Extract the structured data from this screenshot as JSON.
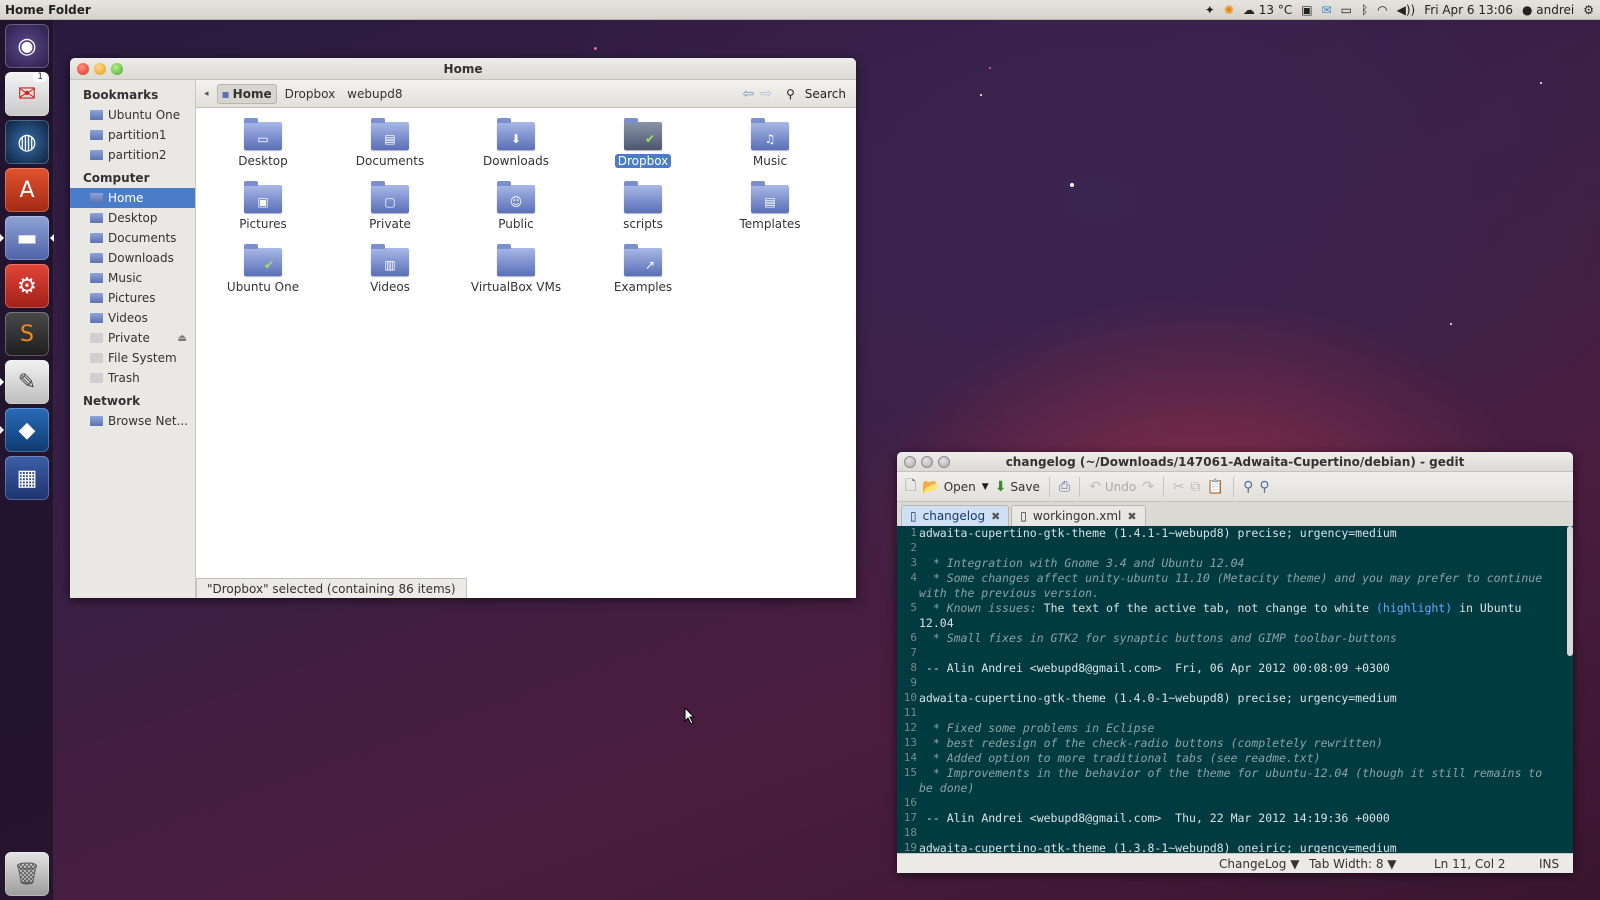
{
  "top_panel": {
    "window_title": "Home Folder",
    "temperature": "13 °C",
    "clock": "Fri Apr 6 13:06",
    "user": "andrei"
  },
  "launcher": {
    "mail_badge": "1"
  },
  "nautilus": {
    "title": "Home",
    "sidebar": {
      "bookmarks_header": "Bookmarks",
      "bookmarks": [
        "Ubuntu One",
        "partition1",
        "partition2"
      ],
      "computer_header": "Computer",
      "computer": [
        "Home",
        "Desktop",
        "Documents",
        "Downloads",
        "Music",
        "Pictures",
        "Videos",
        "Private",
        "File System",
        "Trash"
      ],
      "network_header": "Network",
      "network": [
        "Browse Net..."
      ]
    },
    "breadcrumbs": [
      "Home",
      "Dropbox",
      "webupd8"
    ],
    "search_label": "Search",
    "items": [
      "Desktop",
      "Documents",
      "Downloads",
      "Dropbox",
      "Music",
      "Pictures",
      "Private",
      "Public",
      "scripts",
      "Templates",
      "Ubuntu One",
      "Videos",
      "VirtualBox VMs",
      "Examples"
    ],
    "selected_item": "Dropbox",
    "status": "\"Dropbox\" selected (containing 86 items)"
  },
  "gedit": {
    "title": "changelog (~/Downloads/147061-Adwaita-Cupertino/debian) - gedit",
    "toolbar": {
      "open": "Open",
      "save": "Save",
      "undo": "Undo"
    },
    "tabs": [
      "changelog",
      "workingon.xml"
    ],
    "line_numbers": [
      "1",
      "2",
      "3",
      "4",
      "5",
      "6",
      "7",
      "8",
      "9",
      "10",
      "11",
      "12",
      "13",
      "14",
      "15",
      "16",
      "17",
      "18",
      "19"
    ],
    "lines": {
      "l1": "adwaita-cupertino-gtk-theme (1.4.1-1~webupd8) precise; urgency=medium",
      "l3": "  * Integration with Gnome 3.4 and Ubuntu 12.04",
      "l4": "  * Some changes affect unity-ubuntu 11.10 (Metacity theme) and you may prefer to continue with the previous version.",
      "l5a": "  * Known issues: ",
      "l5b": "The text of the active tab, not change to white ",
      "l5c": "(highlight)",
      "l5d": " in Ubuntu 12.04",
      "l6": "  * Small fixes in GTK2 for synaptic buttons and GIMP toolbar-buttons",
      "l8": " -- Alin Andrei <webupd8@gmail.com>  Fri, 06 Apr 2012 00:08:09 +0300",
      "l10": "adwaita-cupertino-gtk-theme (1.4.0-1~webupd8) precise; urgency=medium",
      "l12": "  * Fixed some problems in Eclipse",
      "l13": "  * best redesign of the check-radio buttons (completely rewritten)",
      "l14": "  * Added option to more traditional tabs (see readme.txt)",
      "l15": "  * Improvements in the behavior of the theme for ubuntu-12.04 (though it still remains to be done)",
      "l17": " -- Alin Andrei <webupd8@gmail.com>  Thu, 22 Mar 2012 14:19:36 +0000",
      "l19": "adwaita-cupertino-gtk-theme (1.3.8-1~webupd8) oneiric; urgency=medium"
    },
    "status": {
      "language": "ChangeLog ▼",
      "tab_width": "Tab Width:  8 ▼",
      "position": "Ln 11, Col 2",
      "mode": "INS"
    }
  }
}
